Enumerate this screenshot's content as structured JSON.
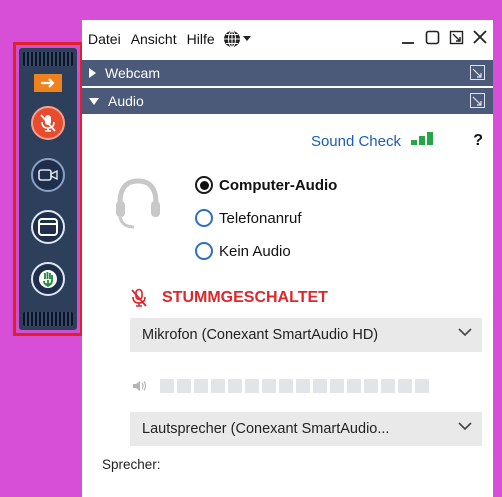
{
  "toolbar": {
    "buttons": [
      {
        "name": "collapse",
        "icon": "arrow-right-icon"
      },
      {
        "name": "mute-audio",
        "icon": "mic-off-icon"
      },
      {
        "name": "video",
        "icon": "camera-icon"
      },
      {
        "name": "screen-share",
        "icon": "window-icon"
      },
      {
        "name": "raise-hand",
        "icon": "hand-icon"
      }
    ],
    "colors": {
      "background": "#2e3f5c",
      "accent": "#f0821e",
      "mute": "#e84b2d",
      "highlight_border": "#e0202a"
    }
  },
  "menu": {
    "items": [
      "Datei",
      "Ansicht",
      "Hilfe"
    ],
    "language_icon": "globe-icon"
  },
  "window_controls": [
    "minimize",
    "restore",
    "popout",
    "close"
  ],
  "sections": {
    "webcam": {
      "label": "Webcam",
      "expanded": false
    },
    "audio": {
      "label": "Audio",
      "expanded": true
    }
  },
  "audio": {
    "sound_check": "Sound Check",
    "help": "?",
    "options": [
      "Computer-Audio",
      "Telefonanruf",
      "Kein Audio"
    ],
    "selected_option": "Computer-Audio",
    "mute_status": "STUMMGESCHALTET",
    "microphone": "Mikrofon (Conexant SmartAudio HD)",
    "speaker": "Lautsprecher (Conexant SmartAudio...",
    "speaker_level": 0,
    "speaker_label": "Sprecher:"
  }
}
